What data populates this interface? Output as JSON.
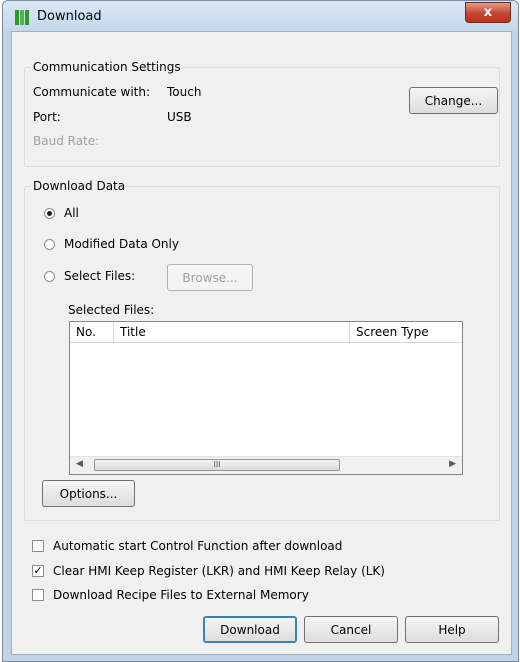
{
  "window": {
    "title": "Download",
    "close_glyph": "x"
  },
  "communication": {
    "legend": "Communication Settings",
    "communicate_with_label": "Communicate with:",
    "communicate_with_value": "Touch",
    "port_label": "Port:",
    "port_value": "USB",
    "baud_rate_label": "Baud Rate:",
    "change_button": "Change..."
  },
  "download_data": {
    "legend": "Download Data",
    "options": [
      {
        "label": "All",
        "selected": true
      },
      {
        "label": "Modified Data Only",
        "selected": false
      },
      {
        "label": "Select Files:",
        "selected": false
      }
    ],
    "browse_button": "Browse...",
    "selected_files_label": "Selected Files:",
    "columns": [
      "No.",
      "Title",
      "Screen Type"
    ],
    "scroll_thumb_grip": "III",
    "options_button": "Options..."
  },
  "checkboxes": [
    {
      "label": "Automatic start Control Function after download",
      "checked": false
    },
    {
      "label": "Clear HMI Keep Register (LKR) and HMI Keep Relay (LK)",
      "checked": true
    },
    {
      "label": "Download Recipe Files to External Memory",
      "checked": false
    }
  ],
  "check_glyph": "✓",
  "buttons": {
    "download": "Download",
    "cancel": "Cancel",
    "help": "Help"
  },
  "colors": {
    "titlebar": "#c5d7ec",
    "close_button": "#c5452f",
    "dialog_face": "#f0f0f0"
  }
}
